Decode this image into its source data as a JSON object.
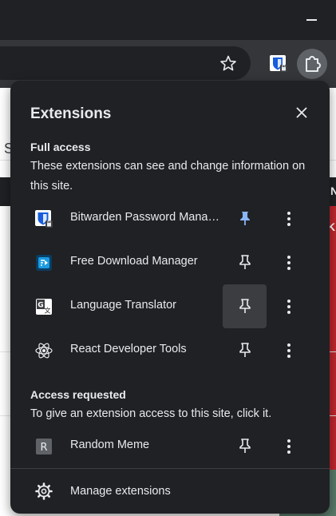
{
  "colors": {
    "panel_bg": "#202124",
    "text": "#e8eaed",
    "pinned_accent": "#8ab4f8",
    "titlebar": "#202124",
    "toolbar": "#35363a"
  },
  "browser": {
    "minimize_icon": "minimize-icon",
    "bookmark_icon": "star-icon",
    "bitwarden_toolbar_icon": "bitwarden-shield-icon",
    "extensions_icon": "puzzle-icon",
    "background": {
      "partial_letter_s": "S",
      "partial_letter_n": "N",
      "partial_letter_k": "K"
    }
  },
  "panel": {
    "title": "Extensions",
    "close_icon": "close-icon",
    "full_access": {
      "title": "Full access",
      "description": "These extensions can see and change information on this site."
    },
    "extensions": [
      {
        "name": "Bitwarden Password Manager",
        "icon": "bitwarden-icon",
        "pinned": true
      },
      {
        "name": "Free Download Manager",
        "icon": "free-download-manager-icon",
        "pinned": false
      },
      {
        "name": "Language Translator",
        "icon": "language-translator-icon",
        "pinned": false
      },
      {
        "name": "React Developer Tools",
        "icon": "react-icon",
        "pinned": false
      }
    ],
    "access_requested": {
      "title": "Access requested",
      "description": "To give an extension access to this site, click it."
    },
    "requested_extensions": [
      {
        "name": "Random Meme",
        "icon": "random-meme-icon",
        "icon_letter": "R",
        "pinned": false
      }
    ],
    "manage": {
      "label": "Manage extensions",
      "icon": "gear-icon"
    }
  }
}
